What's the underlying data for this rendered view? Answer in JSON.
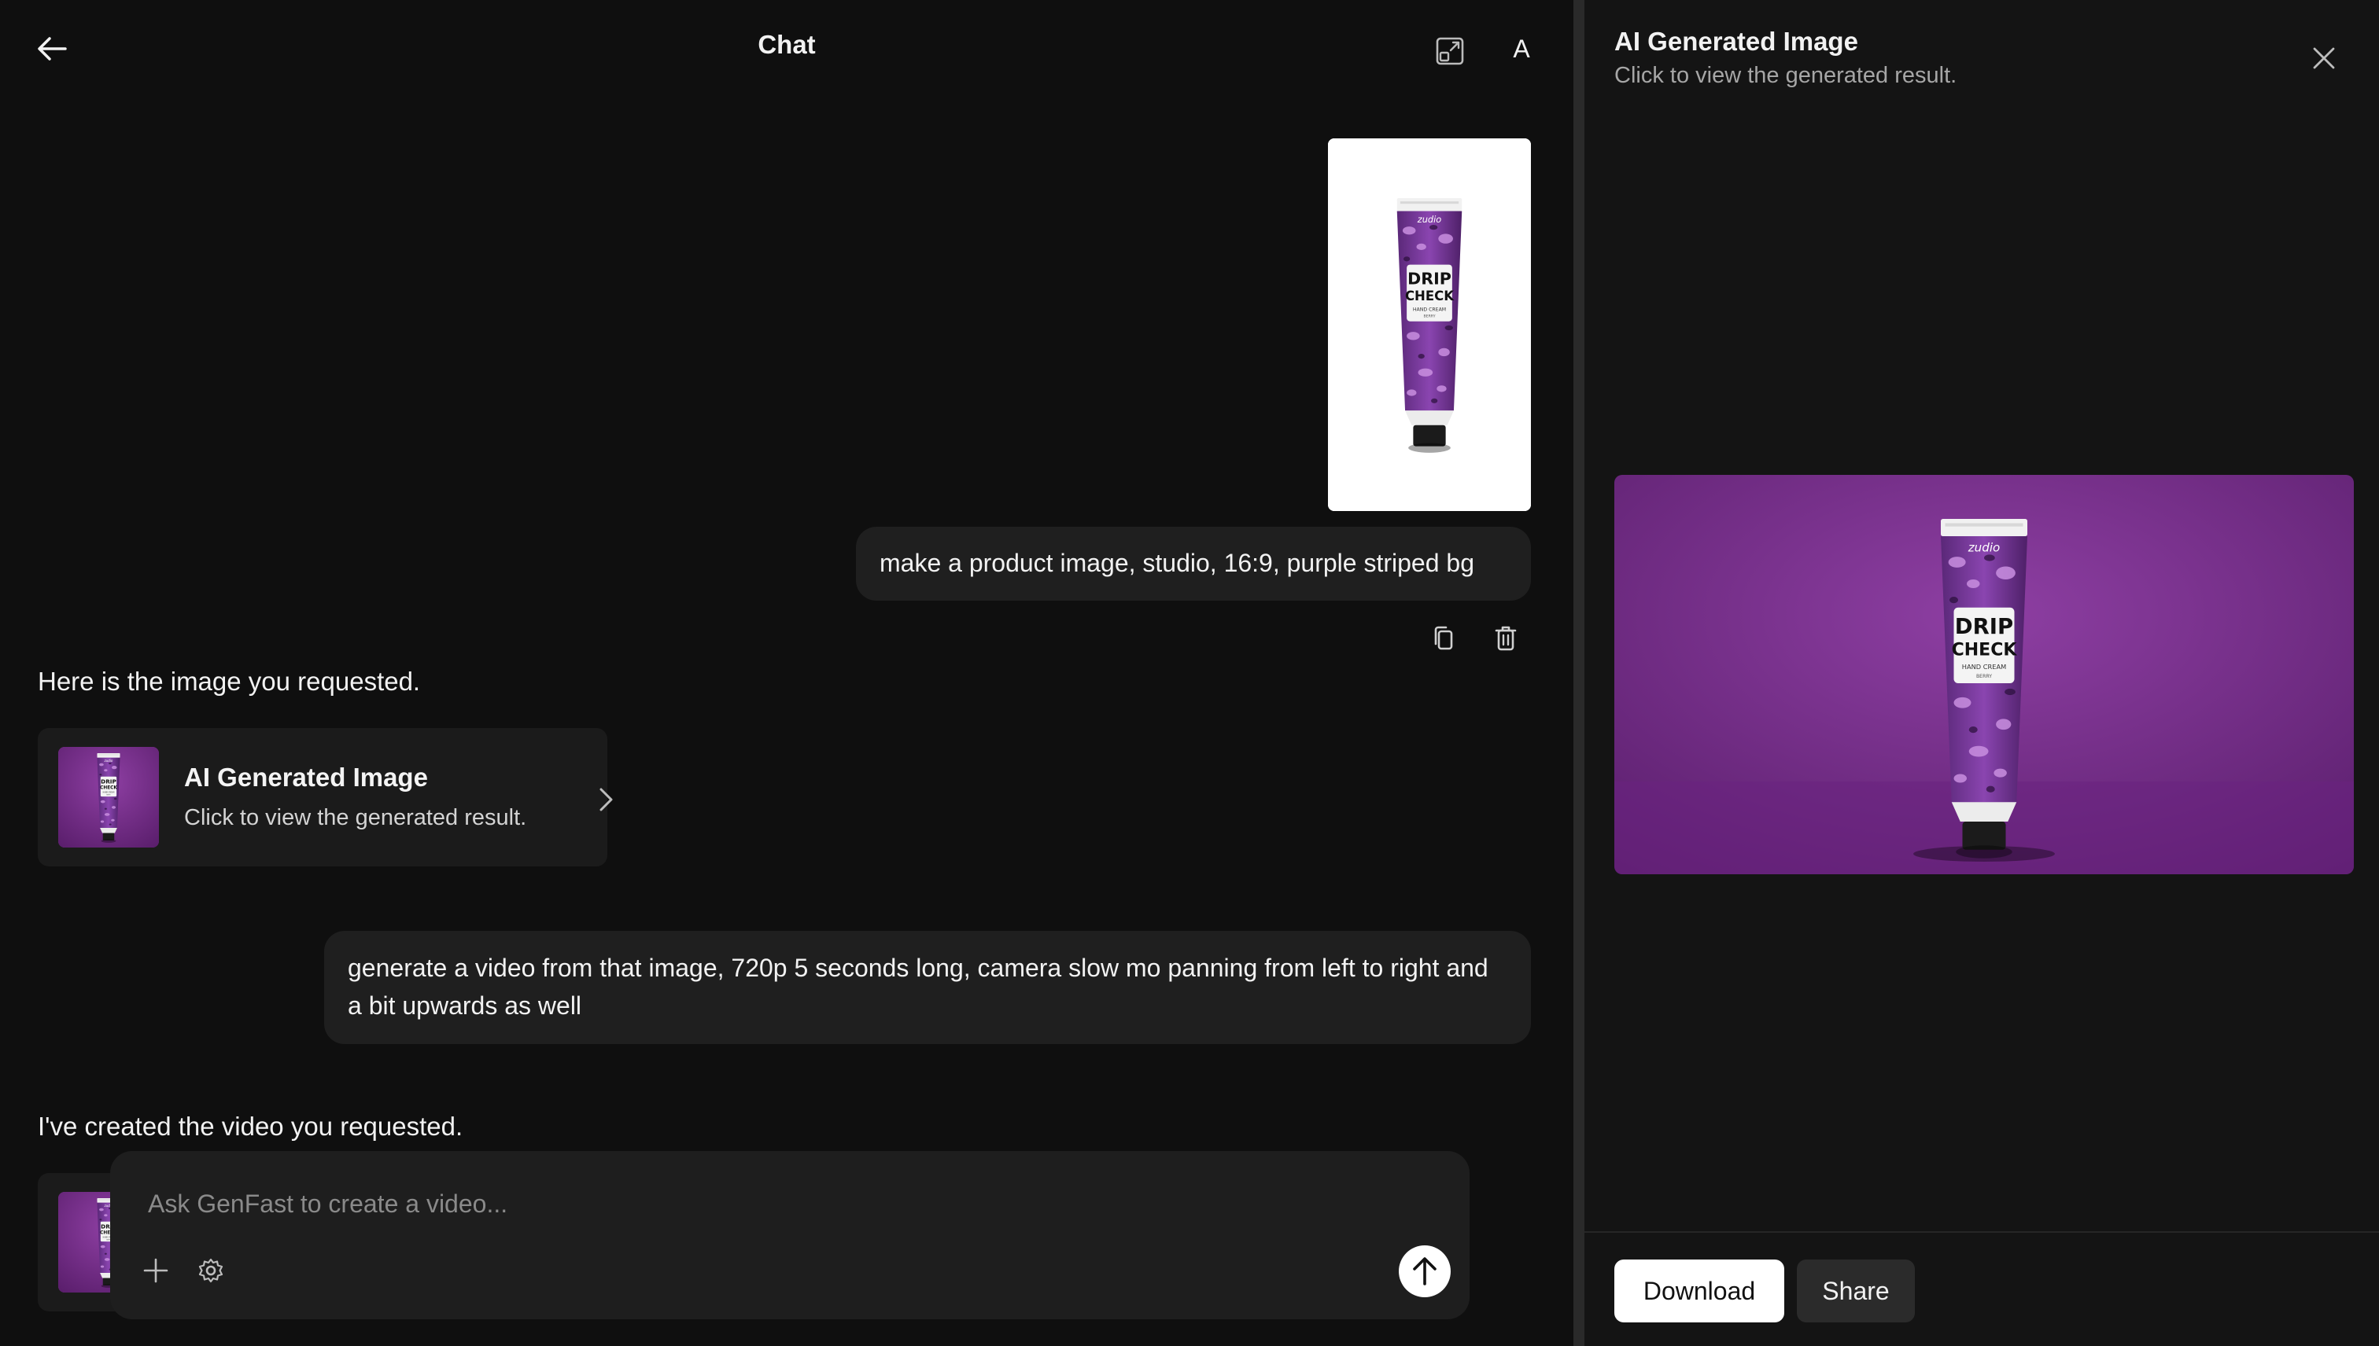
{
  "header": {
    "title": "Chat",
    "avatar_letter": "A"
  },
  "messages": {
    "user_prompt_1": "make a product image, studio, 16:9, purple striped bg",
    "assistant_reply_1": "Here is the image you requested.",
    "user_prompt_2": "generate a video from that image, 720p 5 seconds long, camera slow mo panning from left to right and a bit upwards as well",
    "assistant_reply_2": "I've created the video you requested."
  },
  "product": {
    "brand": "zudio",
    "name_line_1": "DRIP",
    "name_line_2": "CHECK",
    "type": "HAND CREAM",
    "variant": "BERRY"
  },
  "result_card": {
    "title": "AI Generated Image",
    "subtitle": "Click to view the generated result."
  },
  "composer": {
    "placeholder": "Ask GenFast to create a video..."
  },
  "preview": {
    "title": "AI Generated Image",
    "subtitle": "Click to view the generated result.",
    "download_label": "Download",
    "share_label": "Share"
  },
  "icons": {
    "back": "arrow-left-icon",
    "expand": "expand-icon",
    "copy": "copy-icon",
    "delete": "trash-icon",
    "chevron": "chevron-right-icon",
    "add": "plus-icon",
    "settings": "gear-icon",
    "send": "arrow-up-icon",
    "close": "close-icon"
  },
  "colors": {
    "background": "#0f0f0f",
    "bubble": "#1f1f1f",
    "card": "#1b1b1b",
    "preview_bg": "#7a2e8e",
    "tube_purple": "#7b3aa0"
  }
}
